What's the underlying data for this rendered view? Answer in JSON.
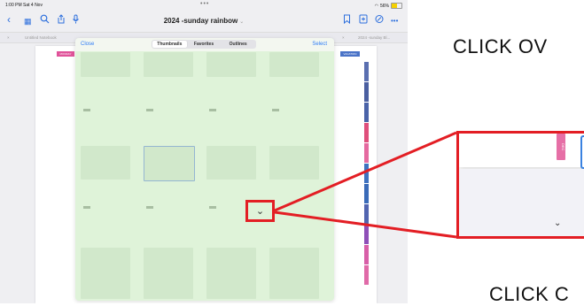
{
  "status_bar": {
    "time": "1:00 PM  Sat 4 Nov",
    "dots": "•••",
    "battery": "56%"
  },
  "toolbar": {
    "title": "2024 -sunday rainbow",
    "title_chevron": "⌄",
    "back_icon": "chevron-left-icon",
    "icons_left": [
      "grid-icon",
      "search-icon",
      "share-icon",
      "microphone-icon"
    ],
    "icons_right": [
      "bookmark-icon",
      "add-page-icon",
      "pen-icon",
      "more-icon"
    ],
    "more": "•••"
  },
  "tabs": [
    {
      "close": "×",
      "label": "Untitled Notebook"
    },
    {
      "close": "×",
      "label": "2024 -sunday Bl..."
    }
  ],
  "page": {
    "flag_left": "MONDAY",
    "flag_right": "VACATION"
  },
  "sheet": {
    "close": "Close",
    "select": "Select",
    "segments": [
      "Thumbnails",
      "Favorites",
      "Outlines"
    ],
    "active_segment": "Thumbnails",
    "expand_chevron": "⌄"
  },
  "zoom": {
    "tab_label": "DEC",
    "chevron": "⌄"
  },
  "annotations": {
    "top_text": "CLICK OV",
    "bottom_text": "CLICK C"
  },
  "colors": {
    "highlight": "#e31e24",
    "accent": "#2f7cf6",
    "sheet_bg": "#dff3d9"
  }
}
